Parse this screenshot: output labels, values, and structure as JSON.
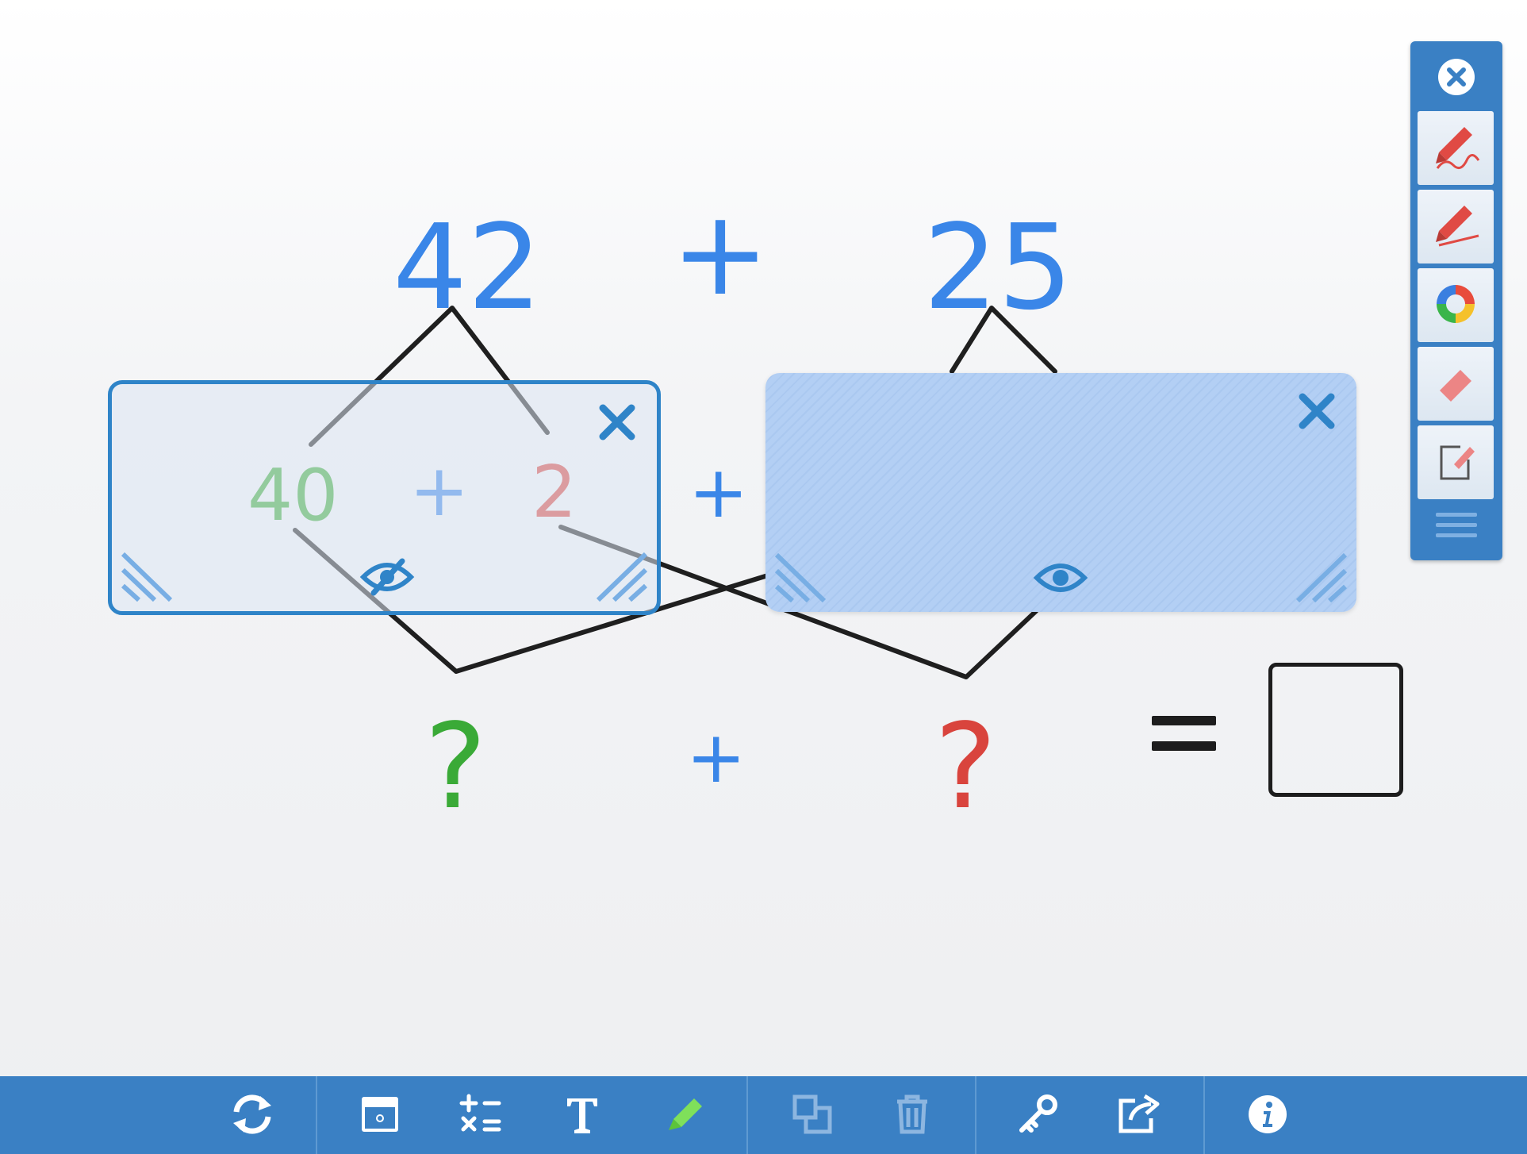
{
  "problem": {
    "top_left_number": "42",
    "top_plus": "+",
    "top_right_number": "25",
    "split_left_part1": "40",
    "split_inner_plus": "+",
    "split_left_part2": "2",
    "middle_plus": "+",
    "bottom_left_unknown": "?",
    "bottom_plus": "+",
    "bottom_right_unknown": "?",
    "equals": "="
  },
  "colors": {
    "blue": "#3a86e8",
    "green": "#3aaa37",
    "red": "#d9443d",
    "toolbar": "#3a80c4"
  },
  "icons": {
    "side_panel": [
      "close-icon",
      "freehand-pen-icon",
      "straight-line-pen-icon",
      "color-wheel-icon",
      "eraser-icon",
      "clear-page-icon",
      "drag-handle-icon"
    ],
    "toolbar": [
      "refresh-icon",
      "screen-shade-icon",
      "operations-icon",
      "text-icon",
      "highlighter-icon",
      "duplicate-icon",
      "trash-icon",
      "key-icon",
      "share-icon",
      "info-icon"
    ],
    "masks": [
      "close-icon",
      "eye-off-icon",
      "eye-icon",
      "resize-corner-icon"
    ]
  }
}
